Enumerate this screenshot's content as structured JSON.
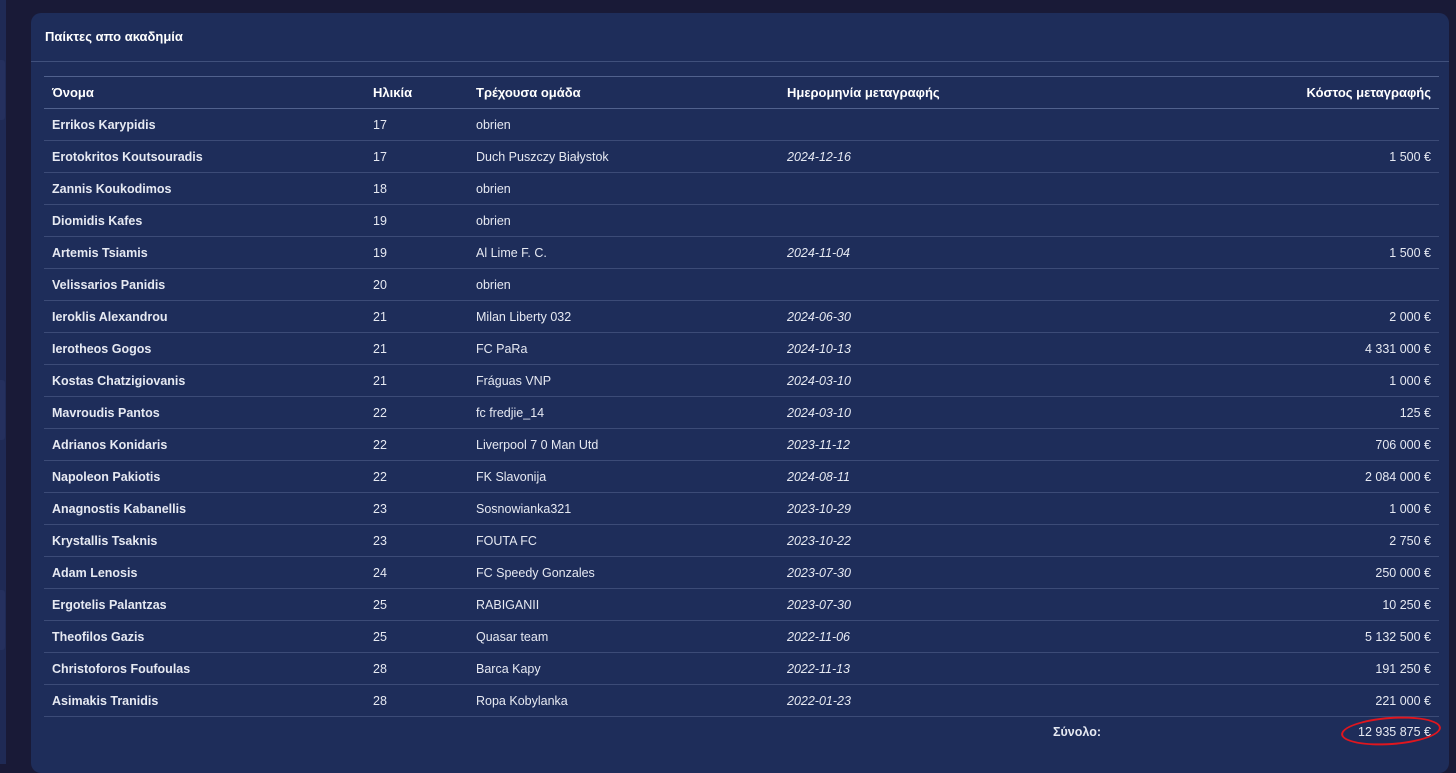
{
  "panel": {
    "title": "Παίκτες απο ακαδημία"
  },
  "table": {
    "columns": [
      "Όνομα",
      "Ηλικία",
      "Τρέχουσα ομάδα",
      "Ημερομηνία μεταγραφής",
      "Κόστος μεταγραφής"
    ],
    "rows": [
      {
        "name": "Errikos Karypidis",
        "age": "17",
        "team": "obrien",
        "date": "",
        "cost": ""
      },
      {
        "name": "Erotokritos Koutsouradis",
        "age": "17",
        "team": "Duch Puszczy Białystok",
        "date": "2024-12-16",
        "cost": "1 500 €"
      },
      {
        "name": "Zannis Koukodimos",
        "age": "18",
        "team": "obrien",
        "date": "",
        "cost": ""
      },
      {
        "name": "Diomidis Kafes",
        "age": "19",
        "team": "obrien",
        "date": "",
        "cost": ""
      },
      {
        "name": "Artemis Tsiamis",
        "age": "19",
        "team": "Al Lime F. C.",
        "date": "2024-11-04",
        "cost": "1 500 €"
      },
      {
        "name": "Velissarios Panidis",
        "age": "20",
        "team": "obrien",
        "date": "",
        "cost": ""
      },
      {
        "name": "Ieroklis Alexandrou",
        "age": "21",
        "team": "Milan Liberty 032",
        "date": "2024-06-30",
        "cost": "2 000 €"
      },
      {
        "name": "Ierotheos Gogos",
        "age": "21",
        "team": "FC PaRa",
        "date": "2024-10-13",
        "cost": "4 331 000 €"
      },
      {
        "name": "Kostas Chatzigiovanis",
        "age": "21",
        "team": "Fráguas VNP",
        "date": "2024-03-10",
        "cost": "1 000 €"
      },
      {
        "name": "Mavroudis Pantos",
        "age": "22",
        "team": "fc fredjie_14",
        "date": "2024-03-10",
        "cost": "125 €"
      },
      {
        "name": "Adrianos Konidaris",
        "age": "22",
        "team": "Liverpool 7 0 Man Utd",
        "date": "2023-11-12",
        "cost": "706 000 €"
      },
      {
        "name": "Napoleon Pakiotis",
        "age": "22",
        "team": "FK Slavonija",
        "date": "2024-08-11",
        "cost": "2 084 000 €"
      },
      {
        "name": "Anagnostis Kabanellis",
        "age": "23",
        "team": "Sosnowianka321",
        "date": "2023-10-29",
        "cost": "1 000 €"
      },
      {
        "name": "Krystallis Tsaknis",
        "age": "23",
        "team": "FOUTA FC",
        "date": "2023-10-22",
        "cost": "2 750 €"
      },
      {
        "name": "Adam Lenosis",
        "age": "24",
        "team": "FC Speedy Gonzales",
        "date": "2023-07-30",
        "cost": "250 000 €"
      },
      {
        "name": "Ergotelis Palantzas",
        "age": "25",
        "team": "RABIGANII",
        "date": "2023-07-30",
        "cost": "10 250 €"
      },
      {
        "name": "Theofilos Gazis",
        "age": "25",
        "team": "Quasar team",
        "date": "2022-11-06",
        "cost": "5 132 500 €"
      },
      {
        "name": "Christoforos Foufoulas",
        "age": "28",
        "team": "Barca Kapy",
        "date": "2022-11-13",
        "cost": "191 250 €"
      },
      {
        "name": "Asimakis Tranidis",
        "age": "28",
        "team": "Ropa Kobylanka",
        "date": "2022-01-23",
        "cost": "221 000 €"
      }
    ],
    "total_label": "Σύνολο:",
    "total_value": "12 935 875 €"
  },
  "annotation": {
    "color": "#e0161e"
  }
}
